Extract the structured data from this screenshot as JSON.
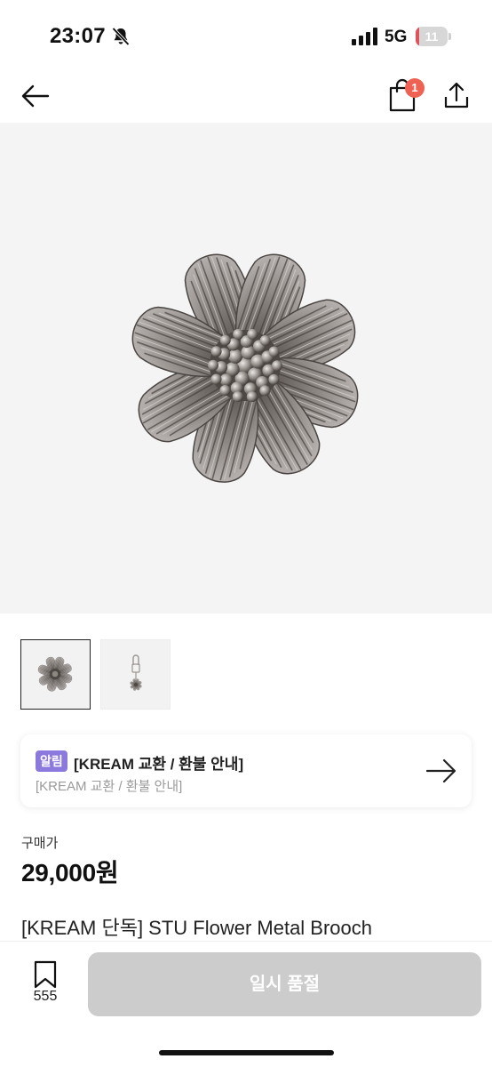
{
  "status_bar": {
    "time": "23:07",
    "network": "5G",
    "battery_level": "11",
    "battery_fraction": 0.11
  },
  "nav": {
    "back_icon": "arrow-left-icon",
    "bag_icon": "shopping-bag-icon",
    "bag_badge_count": "1",
    "share_icon": "share-icon"
  },
  "gallery": {
    "thumbnails": [
      "flower-brooch-front",
      "flower-brooch-on-pin"
    ],
    "selected_index": 0
  },
  "notice": {
    "badge": "알림",
    "title": "[KREAM 교환 / 환불 안내]",
    "subtitle": "[KREAM 교환 / 환불 안내]",
    "arrow_icon": "arrow-right-icon"
  },
  "price": {
    "label": "구매가",
    "value": "29,000원"
  },
  "product": {
    "name": "[KREAM 단독] STU Flower Metal Brooch"
  },
  "bottom_bar": {
    "wish_icon": "bookmark-icon",
    "wish_count": "555",
    "action_label": "일시 품절"
  },
  "colors": {
    "badge_red": "#ef6253",
    "notice_purple": "#8c79de",
    "disabled_button": "#cccccc",
    "battery_low": "#e0525a"
  }
}
